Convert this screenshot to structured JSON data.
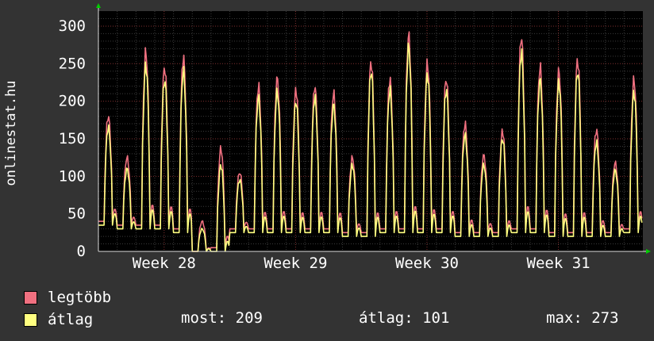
{
  "chart_data": {
    "type": "line",
    "ylabel": "onlinestat.hu",
    "ylim": [
      0,
      320
    ],
    "yticks": [
      0,
      50,
      100,
      150,
      200,
      250,
      300
    ],
    "xticks": [
      "Week 28",
      "Week 29",
      "Week 30",
      "Week 31"
    ],
    "grid": true,
    "legend_position": "bottom-left",
    "series": [
      {
        "name": "legtöbb",
        "color": "#f07080",
        "daily_peaks": [
          180,
          125,
          265,
          245,
          258,
          40,
          137,
          105,
          220,
          230,
          215,
          220,
          210,
          125,
          252,
          230,
          287,
          250,
          230,
          170,
          128,
          160,
          286,
          245,
          240,
          255,
          162,
          118,
          228
        ],
        "daily_lows": [
          40,
          35,
          35,
          35,
          30,
          0,
          5,
          30,
          30,
          30,
          30,
          30,
          30,
          25,
          25,
          30,
          30,
          30,
          30,
          25,
          25,
          25,
          30,
          30,
          25,
          25,
          25,
          25,
          30
        ]
      },
      {
        "name": "átlag",
        "color": "#ffff80",
        "daily_peaks": [
          165,
          110,
          248,
          228,
          240,
          30,
          115,
          95,
          205,
          212,
          200,
          205,
          195,
          115,
          240,
          215,
          272,
          236,
          215,
          155,
          115,
          150,
          265,
          228,
          225,
          240,
          145,
          108,
          212
        ],
        "daily_lows": [
          35,
          30,
          30,
          30,
          25,
          0,
          0,
          25,
          25,
          25,
          25,
          25,
          25,
          20,
          20,
          25,
          25,
          25,
          25,
          20,
          20,
          20,
          25,
          25,
          20,
          20,
          20,
          20,
          25
        ]
      }
    ]
  },
  "legend": [
    {
      "label": "legtöbb",
      "color": "#f07080"
    },
    {
      "label": "átlag",
      "color": "#ffff80"
    }
  ],
  "stats": {
    "most": "most: 209",
    "atlag": "átlag: 101",
    "max": "max: 273"
  }
}
